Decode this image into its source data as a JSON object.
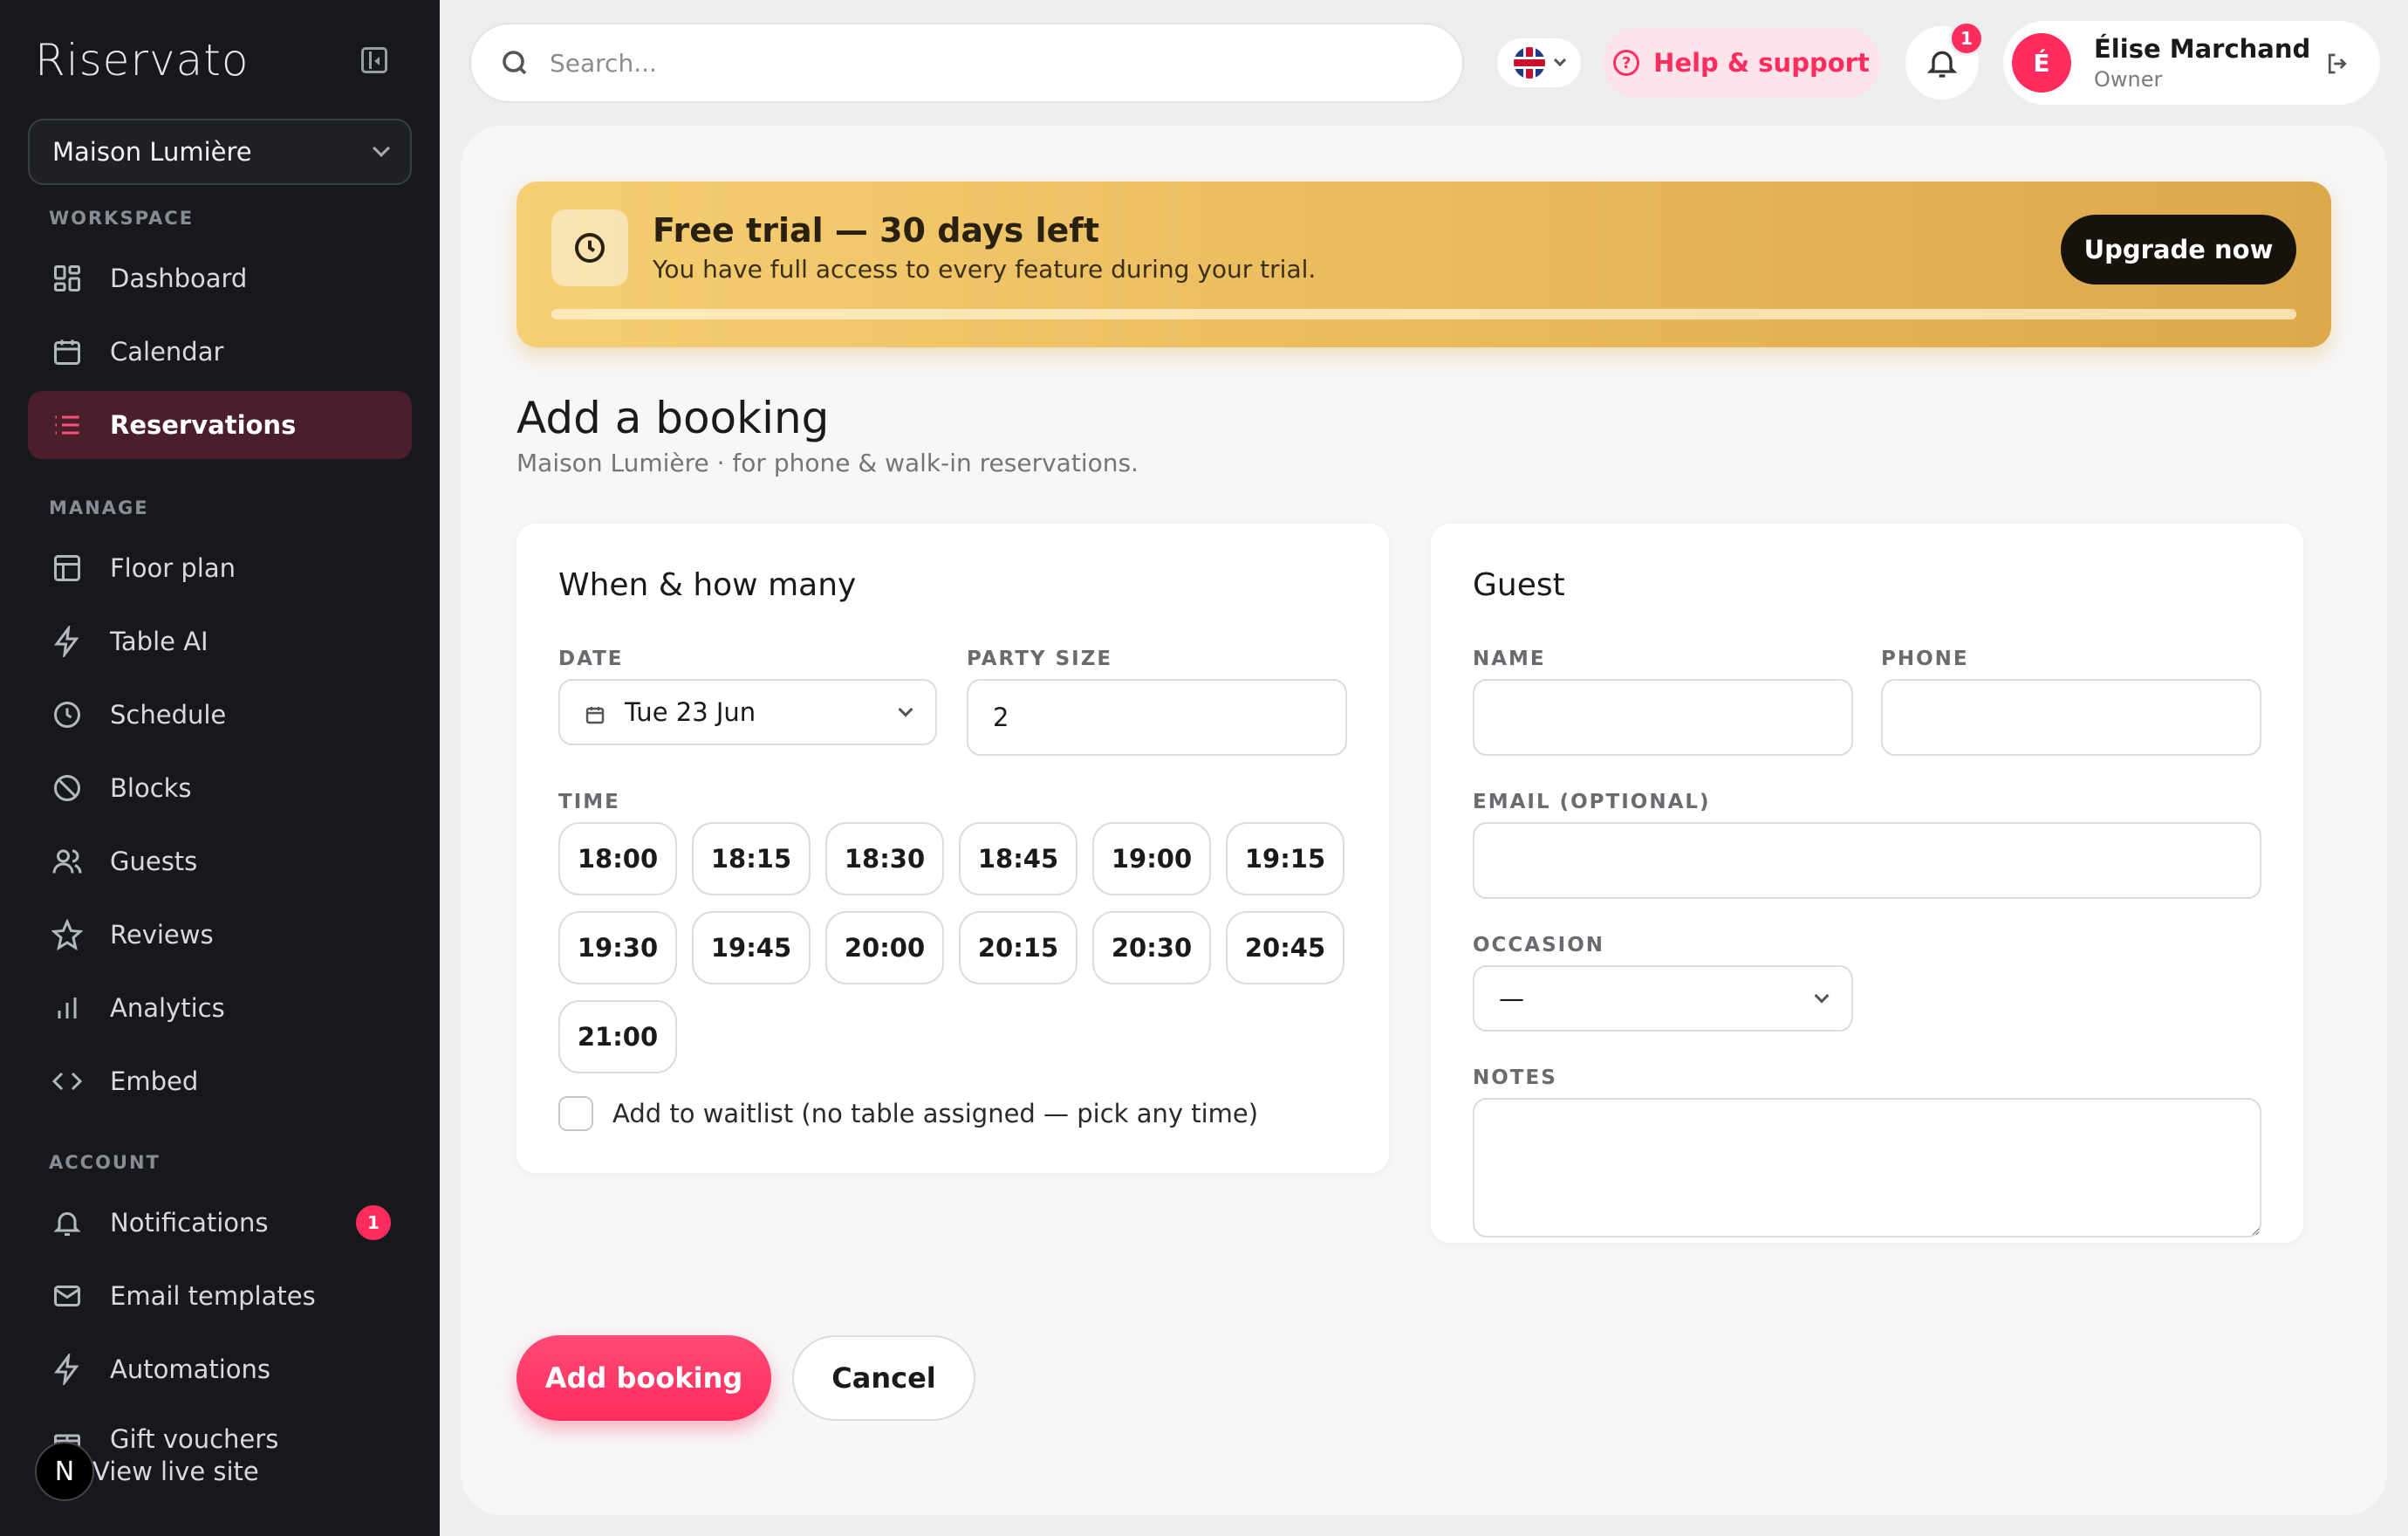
{
  "sidebar": {
    "logo": "Riservato",
    "venue": "Maison Lumière",
    "sections": {
      "workspace": "WORKSPACE",
      "manage": "MANAGE",
      "account": "ACCOUNT"
    },
    "items": {
      "dashboard": "Dashboard",
      "calendar": "Calendar",
      "reservations": "Reservations",
      "floor_plan": "Floor plan",
      "table_ai": "Table AI",
      "schedule": "Schedule",
      "blocks": "Blocks",
      "guests": "Guests",
      "reviews": "Reviews",
      "analytics": "Analytics",
      "embed": "Embed",
      "notifications": "Notifications",
      "email_templates": "Email templates",
      "automations": "Automations",
      "gift_vouchers": "Gift vouchers"
    },
    "notifications_badge": "1",
    "view_live_site": "View live site",
    "n_logo": "N"
  },
  "topbar": {
    "search_placeholder": "Search...",
    "help_label": "Help & support",
    "bell_badge": "1",
    "user_initial": "É",
    "user_name": "Élise Marchand",
    "user_role": "Owner"
  },
  "trial": {
    "title": "Free trial — 30 days left",
    "subtitle": "You have full access to every feature during your trial.",
    "upgrade_label": "Upgrade now"
  },
  "page": {
    "title": "Add a booking",
    "subtitle": "Maison Lumière · for phone & walk-in reservations."
  },
  "when": {
    "title": "When & how many",
    "date_label": "DATE",
    "date_value": "Tue 23 Jun",
    "party_label": "PARTY SIZE",
    "party_value": "2",
    "time_label": "TIME",
    "slots": [
      "18:00",
      "18:15",
      "18:30",
      "18:45",
      "19:00",
      "19:15",
      "19:30",
      "19:45",
      "20:00",
      "20:15",
      "20:30",
      "20:45",
      "21:00"
    ],
    "waitlist_label": "Add to waitlist (no table assigned — pick any time)"
  },
  "guest": {
    "title": "Guest",
    "name_label": "NAME",
    "phone_label": "PHONE",
    "email_label": "EMAIL (OPTIONAL)",
    "occasion_label": "OCCASION",
    "occasion_value": "—",
    "notes_label": "NOTES"
  },
  "actions": {
    "add_label": "Add booking",
    "cancel_label": "Cancel"
  },
  "colors": {
    "accent": "#ff2d5e",
    "sidebar_bg": "#17181d",
    "trial_gold": "#e8b85c"
  }
}
